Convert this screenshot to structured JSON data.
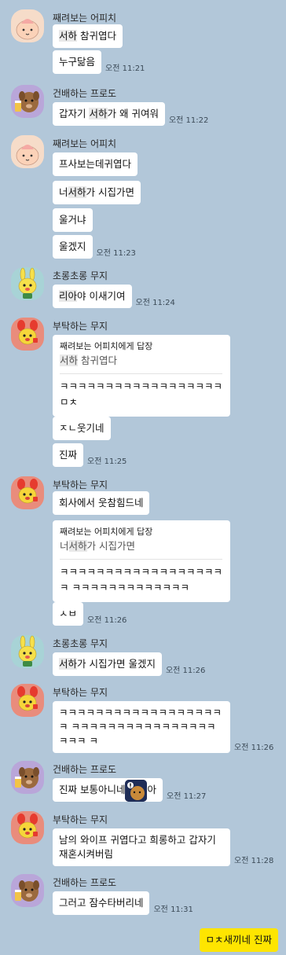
{
  "colors": {
    "background": "#b2c7d9",
    "bubble_other": "#ffffff",
    "bubble_mine": "#fee500"
  },
  "senders": {
    "apeach": "째려보는 어피치",
    "frodo": "건배하는 프로도",
    "muzi_green": "초롱초롱 무지",
    "muzi_red": "부탁하는 무지"
  },
  "avatars": {
    "apeach": "apeach-icon",
    "frodo": "frodo-icon",
    "muzi_green": "muzi-green-icon",
    "muzi_red": "muzi-red-icon"
  },
  "g1": {
    "m1_hl": "서하",
    "m1_rest": " 참귀엽다",
    "m2": "누구닮음",
    "time": "오전 11:21"
  },
  "g2": {
    "m1_pre": "갑자기 ",
    "m1_hl": "서하",
    "m1_rest": "가 왜 귀여워",
    "time": "오전 11:22"
  },
  "g3": {
    "m1": "프사보는데귀엽다",
    "m2_pre": "너",
    "m2_hl": "서하",
    "m2_rest": "가 시집가면",
    "m3": "울거냐",
    "m4": "울겠지",
    "time": "오전 11:23"
  },
  "g4": {
    "m1_hl": "리아",
    "m1_rest": "야 이새기여",
    "time": "오전 11:24"
  },
  "g5": {
    "reply_head": "째려보는 어피치에게 답장",
    "reply_hl": "서하",
    "reply_rest": " 참귀엽다",
    "reply_text": "ㅋㅋㅋㅋㅋㅋㅋㅋㅋㅋㅋㅋㅋㅋㅋㅋㅋㅋ ㅁㅊ",
    "m2": "ㅈㄴ웃기네",
    "m3": "진짜",
    "time": "오전 11:25"
  },
  "g6": {
    "m1": "회사에서 웃참힘드네",
    "reply_head": "째려보는 어피치에게 답장",
    "reply_pre": "너",
    "reply_hl": "서하",
    "reply_rest": "가 시집가면",
    "reply_text": "ㅋㅋㅋㅋㅋㅋㅋㅋㅋㅋㅋㅋㅋㅋㅋㅋㅋㅋㅋ ㅋㅋㅋㅋㅋㅋㅋㅋㅋㅋㅋㅋㅋ",
    "m3": "ㅅㅂ",
    "time": "오전 11:26"
  },
  "g7": {
    "m1_hl": "서하",
    "m1_rest": "가 시집가면 울겠지",
    "time": "오전 11:26"
  },
  "g8": {
    "m1": "ㅋㅋㅋㅋㅋㅋㅋㅋㅋㅋㅋㅋㅋㅋㅋㅋㅋㅋㅋ ㅋㅋㅋㅋㅋㅋㅋㅋㅋㅋㅋㅋㅋㅋㅋㅋㅋㅋㅋ ㅋ",
    "time": "오전 11:26"
  },
  "g9": {
    "m1_pre": "진짜 보통아니네",
    "m1_post": "아",
    "sticker": "ryan-emoticon-icon",
    "time": "오전 11:27"
  },
  "g10": {
    "m1": "남의 와이프 귀엽다고 희롱하고 갑자기 재혼시켜버림",
    "time": "오전 11:28"
  },
  "g11": {
    "m1": "그러고 잠수타버리네",
    "time": "오전 11:31"
  },
  "mine": {
    "m1": "ㅁㅊ새끼네 진짜"
  }
}
